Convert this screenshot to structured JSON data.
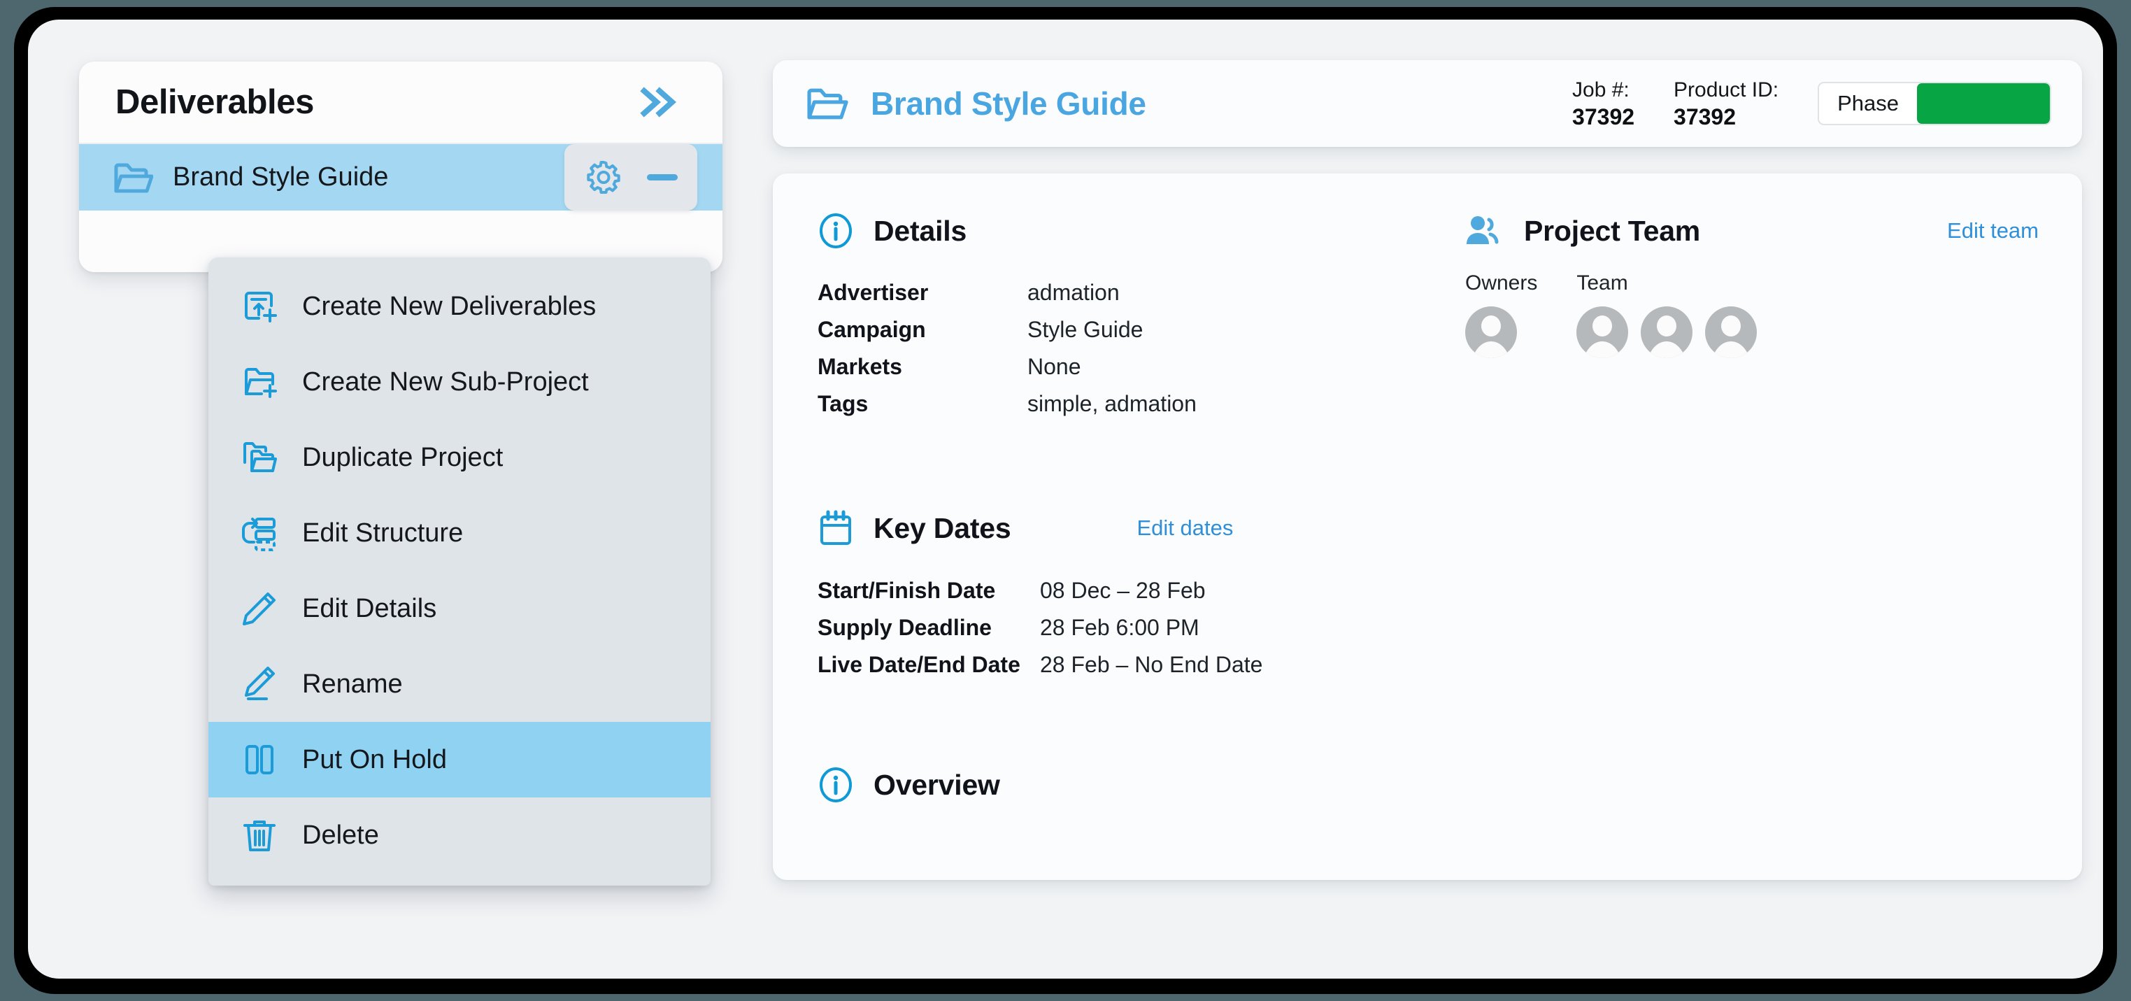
{
  "theme": {
    "accent_blue": "#4fa9dd",
    "title_blue": "#4aa6e0",
    "link_blue": "#2f8fd8",
    "selection_blue": "#a4d8f2",
    "menu_highlight_blue": "#8fd2f2",
    "menu_bg": "#dfe4e9",
    "phase_green": "#07a544",
    "app_bg": "#f1f3f5",
    "frame_black": "#000000",
    "backdrop": "#4e676f"
  },
  "sidebar": {
    "title": "Deliverables",
    "collapse_icon": "double-chevron-right-icon",
    "selected_item": {
      "label": "Brand Style Guide",
      "icon": "open-folder-icon",
      "gear_icon": "gear-icon",
      "collapse_icon": "minus-icon"
    }
  },
  "context_menu": {
    "items": [
      {
        "label": "Create New Deliverables",
        "icon": "upload-document-plus-icon",
        "active": false
      },
      {
        "label": "Create New Sub-Project",
        "icon": "folder-plus-icon",
        "active": false
      },
      {
        "label": "Duplicate Project",
        "icon": "copy-folders-icon",
        "active": false
      },
      {
        "label": "Edit Structure",
        "icon": "edit-structure-icon",
        "active": false
      },
      {
        "label": "Edit Details",
        "icon": "pencil-icon",
        "active": false
      },
      {
        "label": "Rename",
        "icon": "pencil-underline-icon",
        "active": false
      },
      {
        "label": "Put On Hold",
        "icon": "pause-icon",
        "active": true
      },
      {
        "label": "Delete",
        "icon": "trash-icon",
        "active": false
      }
    ]
  },
  "header": {
    "folder_icon": "open-folder-icon",
    "title": "Brand Style Guide",
    "job_label": "Job #:",
    "job_value": "37392",
    "product_label": "Product ID:",
    "product_value": "37392",
    "phase_label": "Phase"
  },
  "details": {
    "icon": "info-circle-icon",
    "title": "Details",
    "rows": [
      {
        "key": "Advertiser",
        "value": "admation"
      },
      {
        "key": "Campaign",
        "value": "Style Guide"
      },
      {
        "key": "Markets",
        "value": "None"
      },
      {
        "key": "Tags",
        "value": "simple, admation"
      }
    ]
  },
  "project_team": {
    "icon": "people-icon",
    "title": "Project Team",
    "edit_link": "Edit team",
    "groups": [
      {
        "label": "Owners",
        "count": 1
      },
      {
        "label": "Team",
        "count": 3
      }
    ]
  },
  "key_dates": {
    "icon": "calendar-icon",
    "title": "Key Dates",
    "edit_link": "Edit dates",
    "rows": [
      {
        "key": "Start/Finish Date",
        "value": "08 Dec – 28 Feb"
      },
      {
        "key": "Supply Deadline",
        "value": "28 Feb 6:00 PM"
      },
      {
        "key": "Live Date/End Date",
        "value": "28 Feb – No End Date"
      }
    ]
  },
  "overview": {
    "icon": "info-circle-icon",
    "title": "Overview"
  }
}
